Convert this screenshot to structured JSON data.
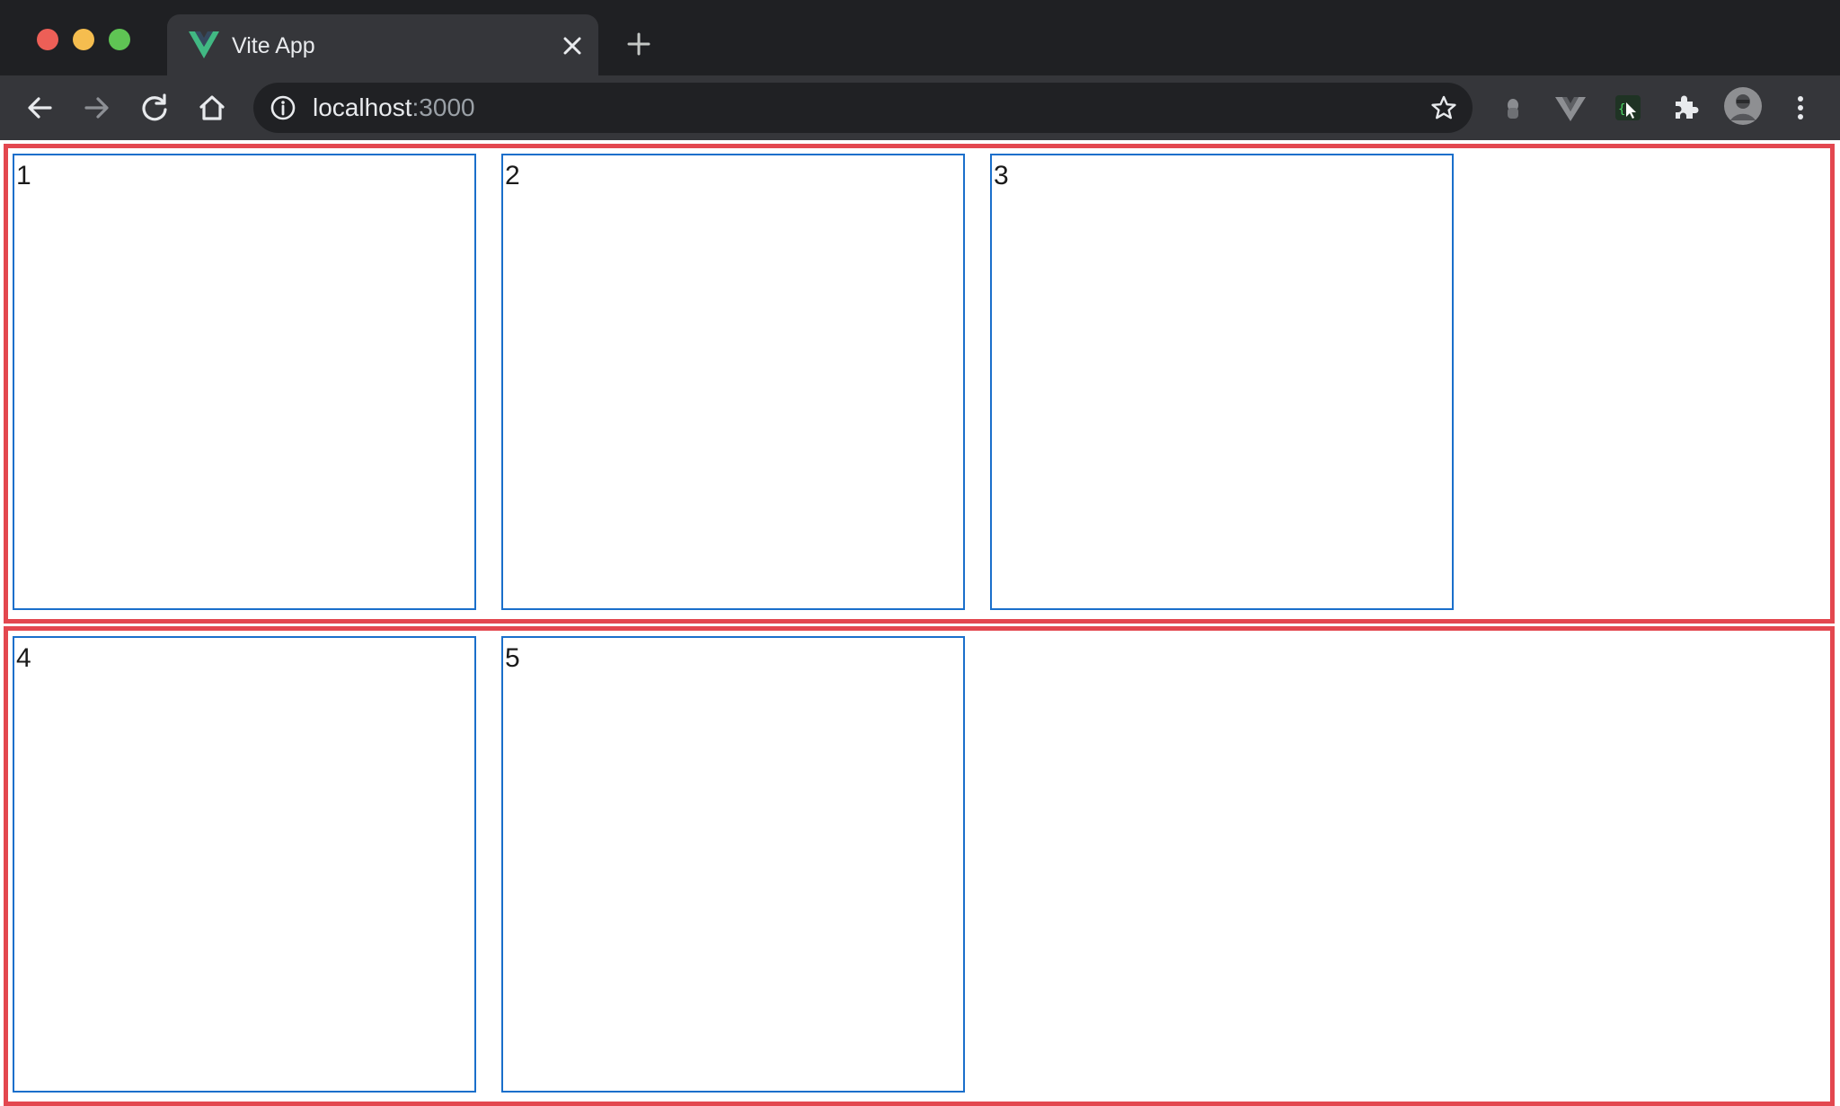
{
  "window": {
    "traffic_lights": [
      "close",
      "minimize",
      "zoom"
    ]
  },
  "tab": {
    "title": "Vite App",
    "favicon": "vue-logo-icon"
  },
  "toolbar": {
    "url_host": "localhost",
    "url_port": ":3000",
    "buttons": [
      "back",
      "forward",
      "reload",
      "home"
    ],
    "extensions": [
      "grey-extension-icon",
      "vue-devtools-icon",
      "selector-extension-icon",
      "puzzle-icon",
      "profile-avatar",
      "menu-icon"
    ]
  },
  "page": {
    "rows": [
      {
        "boxes": [
          {
            "label": "1"
          },
          {
            "label": "2"
          },
          {
            "label": "3"
          }
        ]
      },
      {
        "boxes": [
          {
            "label": "4"
          },
          {
            "label": "5"
          }
        ]
      }
    ]
  },
  "colors": {
    "row_border": "#e3474f",
    "box_border": "#1a6fcb",
    "chrome_dark": "#1f2023",
    "chrome_toolbar": "#35363a"
  }
}
